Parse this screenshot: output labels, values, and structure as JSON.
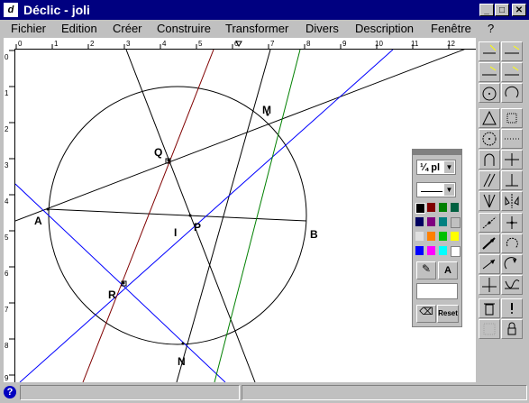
{
  "window": {
    "title": "Déclic - joli",
    "app_icon": "declic-app-icon",
    "controls": [
      "minimize",
      "maximize",
      "close"
    ]
  },
  "menu": {
    "items": [
      "Fichier",
      "Edition",
      "Créer",
      "Construire",
      "Transformer",
      "Divers",
      "Description",
      "Fenêtre",
      "?"
    ]
  },
  "ruler": {
    "top_labels": [
      "0",
      "1",
      "2",
      "3",
      "4",
      "5",
      "6",
      "7",
      "8",
      "9",
      "10",
      "11",
      "12"
    ],
    "left_labels": [
      "0",
      "1",
      "2",
      "3",
      "4",
      "5",
      "6",
      "7",
      "8",
      "9"
    ]
  },
  "figure": {
    "point_labels": {
      "A": "A",
      "B": "B",
      "I": "I",
      "P": "P",
      "M": "M",
      "Q": "Q",
      "R": "R",
      "N": "N"
    },
    "colors": {
      "black": "#000000",
      "blue": "#0000ff",
      "dark_red": "#800000",
      "dark_green": "#008000"
    }
  },
  "toolbar": {
    "tools": [
      "line-tool",
      "segment-tool",
      "parallel-lines-tool",
      "segment-alt-tool",
      "circle-tool",
      "arc-tool",
      "triangle-tool",
      "grid-tool",
      "center-point-tool",
      "dotted-line-tool",
      "intersection-tool",
      "perpendicular-tool",
      "parallel-tool",
      "perpendicular-alt-tool",
      "bisector-tool",
      "symmetry-tool",
      "midpoint-tool",
      "measure-tool",
      "vector-tool",
      "rotation-tool",
      "translate-tool",
      "rotate-points-tool",
      "axis-tool",
      "graph-tool",
      "trash-tool",
      "info-tool",
      "grid-dots-tool",
      "lock-tool"
    ]
  },
  "palette": {
    "line_width": "¼ pl",
    "colors": [
      "#800000",
      "#008000",
      "#006040",
      "#000060",
      "#800080",
      "#008080",
      "#c0c0c0",
      "#ff8000",
      "#00c000",
      "#ffff00",
      "#0000ff",
      "#ff00ff",
      "#00ffff",
      "#ffffff"
    ],
    "reset_label": "Reset"
  },
  "status": {
    "help": "?"
  }
}
